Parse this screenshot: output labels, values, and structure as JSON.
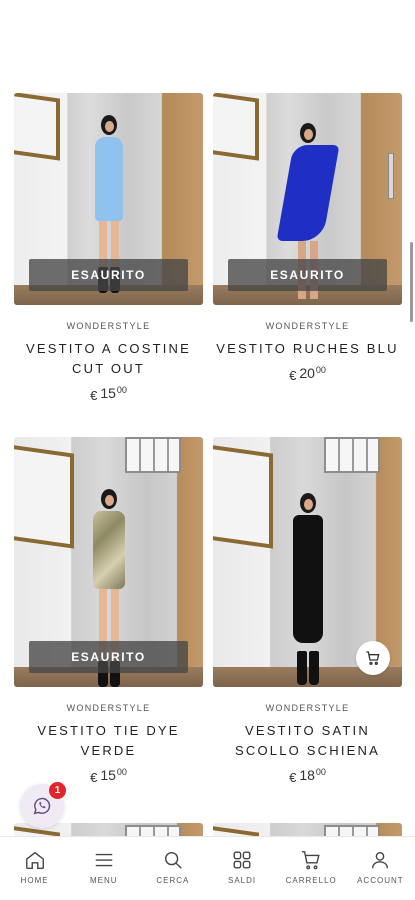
{
  "products": [
    {
      "brand": "WONDERSTYLE",
      "title": "VESTITO A COSTINE CUT OUT",
      "currency": "€",
      "price_int": "15",
      "price_dec": "00",
      "badge": "ESAURITO",
      "dress_color": "#8fc3ee"
    },
    {
      "brand": "WONDERSTYLE",
      "title": "VESTITO RUCHES BLU",
      "currency": "€",
      "price_int": "20",
      "price_dec": "00",
      "badge": "ESAURITO",
      "dress_color": "#1f2fc4"
    },
    {
      "brand": "WONDERSTYLE",
      "title": "VESTITO TIE DYE VERDE",
      "currency": "€",
      "price_int": "15",
      "price_dec": "00",
      "badge": "ESAURITO",
      "dress_color": "#b9ae8d"
    },
    {
      "brand": "WONDERSTYLE",
      "title": "VESTITO SATIN SCOLLO SCHIENA",
      "currency": "€",
      "price_int": "18",
      "price_dec": "00",
      "dress_color": "#111111"
    }
  ],
  "whatsapp": {
    "badge_count": "1",
    "icon": "whatsapp-icon",
    "color": "#e0262a"
  },
  "nav": [
    {
      "label": "HOME",
      "icon": "home-icon"
    },
    {
      "label": "MENU",
      "icon": "menu-icon"
    },
    {
      "label": "CERCA",
      "icon": "search-icon"
    },
    {
      "label": "SALDI",
      "icon": "grid-icon"
    },
    {
      "label": "CARRELLO",
      "icon": "cart-icon"
    },
    {
      "label": "ACCOUNT",
      "icon": "user-icon"
    }
  ]
}
